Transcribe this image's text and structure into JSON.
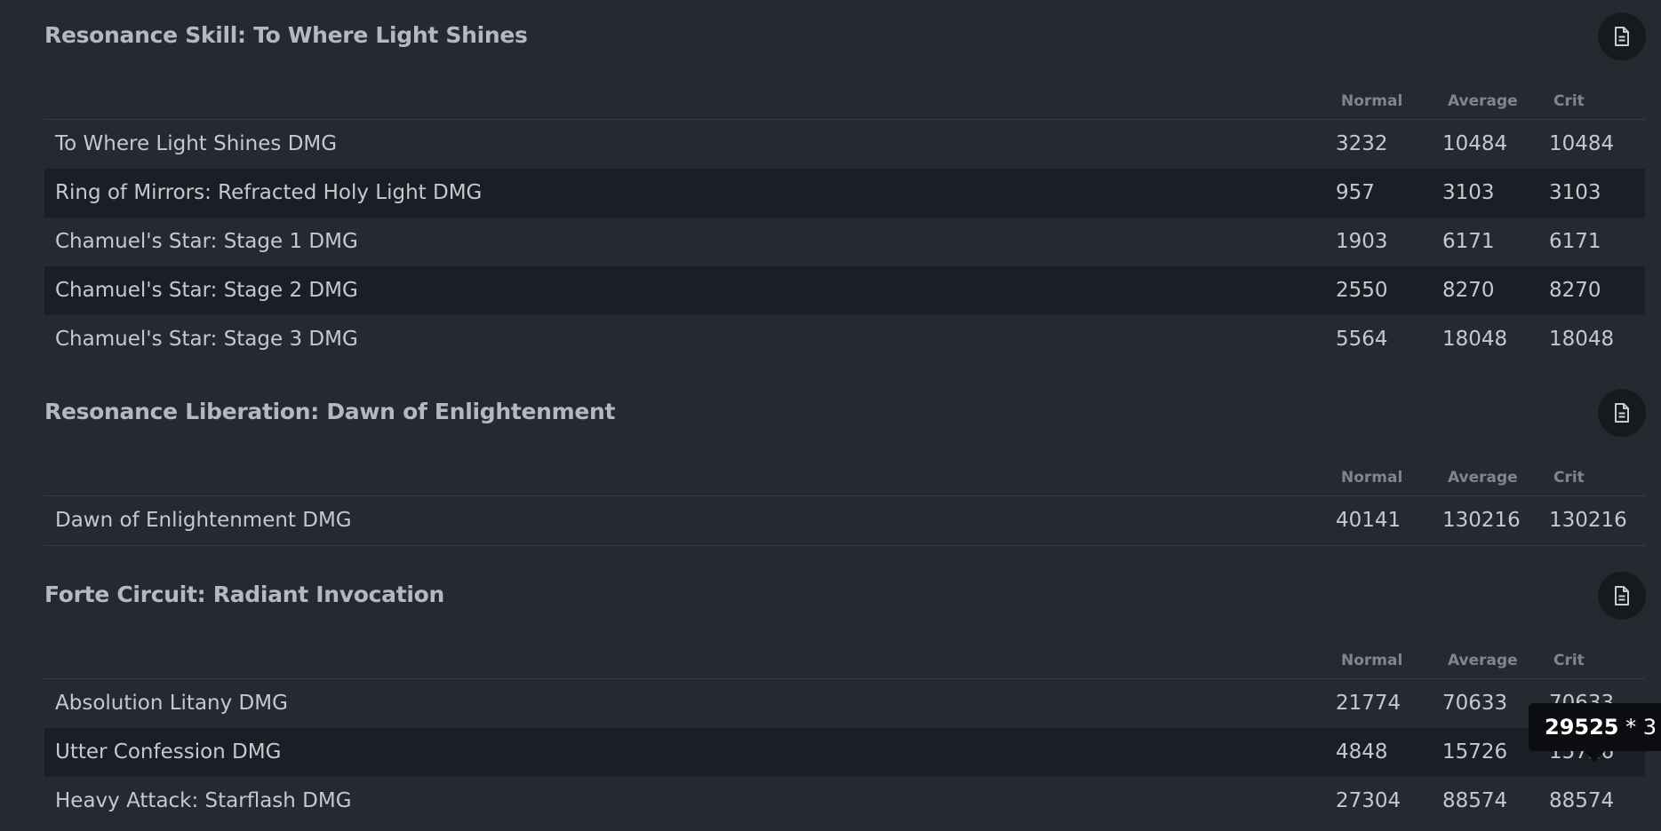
{
  "columns": {
    "normal": "Normal",
    "average": "Average",
    "crit": "Crit"
  },
  "icons": {
    "doc": "document-icon"
  },
  "colors": {
    "background": "#252930",
    "alt_row": "#1b1e24",
    "heading": "#b4b9c1",
    "column_header": "#80868f",
    "text": "#c5c9cf",
    "tooltip_bg": "#0c0d10"
  },
  "sections": [
    {
      "title": "Resonance Skill: To Where Light Shines",
      "rows": [
        {
          "name": "To Where Light Shines DMG",
          "normal": "3232",
          "average": "10484",
          "crit": "10484"
        },
        {
          "name": "Ring of Mirrors: Refracted Holy Light DMG",
          "normal": "957",
          "average": "3103",
          "crit": "3103"
        },
        {
          "name": "Chamuel's Star: Stage 1 DMG",
          "normal": "1903",
          "average": "6171",
          "crit": "6171"
        },
        {
          "name": "Chamuel's Star: Stage 2 DMG",
          "normal": "2550",
          "average": "8270",
          "crit": "8270"
        },
        {
          "name": "Chamuel's Star: Stage 3 DMG",
          "normal": "5564",
          "average": "18048",
          "crit": "18048"
        }
      ]
    },
    {
      "title": "Resonance Liberation: Dawn of Enlightenment",
      "rows": [
        {
          "name": "Dawn of Enlightenment DMG",
          "normal": "40141",
          "average": "130216",
          "crit": "130216"
        }
      ]
    },
    {
      "title": "Forte Circuit: Radiant Invocation",
      "rows": [
        {
          "name": "Absolution Litany DMG",
          "normal": "21774",
          "average": "70633",
          "crit": "70633"
        },
        {
          "name": "Utter Confession DMG",
          "normal": "4848",
          "average": "15726",
          "crit": "15726"
        },
        {
          "name": "Heavy Attack: Starflash DMG",
          "normal": "27304",
          "average": "88574",
          "crit": "88574"
        }
      ]
    }
  ],
  "tooltip": {
    "value": "29525",
    "multiplier": " * 3"
  }
}
